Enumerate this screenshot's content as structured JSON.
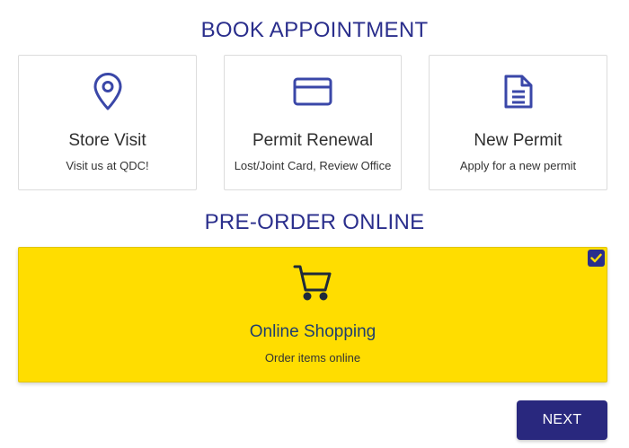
{
  "book_section": {
    "title": "BOOK APPOINTMENT",
    "cards": [
      {
        "icon": "location-pin-icon",
        "title": "Store Visit",
        "subtitle": "Visit us at QDC!"
      },
      {
        "icon": "credit-card-icon",
        "title": "Permit Renewal",
        "subtitle": "Lost/Joint Card, Review Office"
      },
      {
        "icon": "document-icon",
        "title": "New Permit",
        "subtitle": "Apply for a new permit"
      }
    ]
  },
  "preorder_section": {
    "title": "PRE-ORDER ONLINE",
    "card": {
      "icon": "shopping-cart-icon",
      "title": "Online Shopping",
      "subtitle": "Order items online",
      "selected": true,
      "check_icon": "checkmark-icon"
    }
  },
  "actions": {
    "next_label": "NEXT"
  },
  "colors": {
    "accent": "#2a2e8c",
    "selected_bg": "#ffdd00",
    "icon_blue": "#3a47a8",
    "button_bg": "#29287e"
  }
}
